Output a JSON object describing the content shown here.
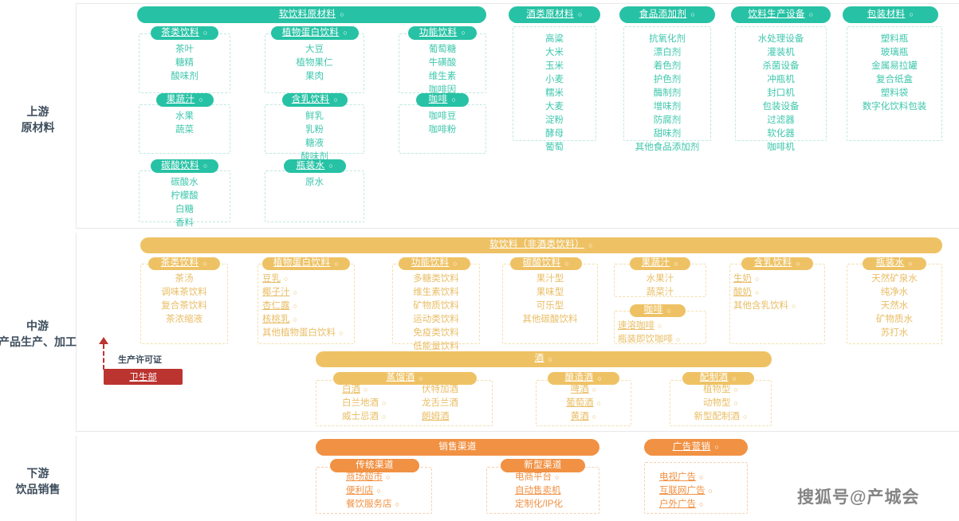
{
  "watermark": "搜狐号@产城会",
  "tiers": [
    {
      "id": "upstream",
      "label_line1": "上游",
      "label_line2": "原材料"
    },
    {
      "id": "midstream",
      "label_line1": "中游",
      "label_line2": "产品生产、加工"
    },
    {
      "id": "downstream",
      "label_line1": "下游",
      "label_line2": "饮品销售"
    }
  ],
  "colors": {
    "green": "#27c2a5",
    "yellow": "#eec264",
    "orange": "#f19143",
    "regulator": "#bc3430",
    "label_text": "#3d4d5c"
  },
  "regulator": {
    "name": "卫生部",
    "relation": "生产许可证"
  },
  "upstream": {
    "banner": {
      "title": "软饮料原材料",
      "dot": "○"
    },
    "groups": [
      {
        "title": "茶类饮料",
        "dot": "○",
        "items": [
          {
            "text": "茶叶"
          },
          {
            "text": "糖精"
          },
          {
            "text": "酸味剂"
          }
        ]
      },
      {
        "title": "植物蛋白饮料",
        "dot": "○",
        "items": [
          {
            "text": "大豆"
          },
          {
            "text": "植物果仁"
          },
          {
            "text": "果肉"
          }
        ]
      },
      {
        "title": "功能饮料",
        "dot": "○",
        "items": [
          {
            "text": "葡萄糖"
          },
          {
            "text": "牛磺酸"
          },
          {
            "text": "维生素"
          },
          {
            "text": "咖啡因"
          }
        ]
      },
      {
        "title": "果蔬汁",
        "dot": "○",
        "items": [
          {
            "text": "水果"
          },
          {
            "text": "蔬菜"
          }
        ]
      },
      {
        "title": "含乳饮料",
        "dot": "○",
        "items": [
          {
            "text": "鲜乳"
          },
          {
            "text": "乳粉"
          },
          {
            "text": "糖液"
          },
          {
            "text": "酸味剂"
          }
        ]
      },
      {
        "title": "咖啡",
        "dot": "○",
        "items": [
          {
            "text": "咖啡豆"
          },
          {
            "text": "咖啡粉"
          }
        ]
      },
      {
        "title": "碳酸饮料",
        "dot": "○",
        "items": [
          {
            "text": "碳酸水"
          },
          {
            "text": "柠檬酸"
          },
          {
            "text": "白糖"
          },
          {
            "text": "香料"
          }
        ]
      },
      {
        "title": "瓶装水",
        "dot": "○",
        "items": [
          {
            "text": "原水"
          }
        ]
      }
    ],
    "side_groups": [
      {
        "title": "酒类原材料",
        "dot": "○",
        "items": [
          {
            "text": "高粱"
          },
          {
            "text": "大米"
          },
          {
            "text": "玉米"
          },
          {
            "text": "小麦"
          },
          {
            "text": "糯米"
          },
          {
            "text": "大麦"
          },
          {
            "text": "淀粉"
          },
          {
            "text": "酵母"
          },
          {
            "text": "葡萄"
          }
        ]
      },
      {
        "title": "食品添加剂",
        "dot": "○",
        "items": [
          {
            "text": "抗氧化剂"
          },
          {
            "text": "漂白剂"
          },
          {
            "text": "着色剂"
          },
          {
            "text": "护色剂"
          },
          {
            "text": "酶制剂"
          },
          {
            "text": "增味剂"
          },
          {
            "text": "防腐剂"
          },
          {
            "text": "甜味剂"
          },
          {
            "text": "其他食品添加剂"
          }
        ]
      },
      {
        "title": "饮料生产设备",
        "dot": "○",
        "items": [
          {
            "text": "水处理设备"
          },
          {
            "text": "灌装机"
          },
          {
            "text": "杀菌设备"
          },
          {
            "text": "冲瓶机"
          },
          {
            "text": "封口机"
          },
          {
            "text": "包装设备"
          },
          {
            "text": "过滤器"
          },
          {
            "text": "软化器"
          },
          {
            "text": "咖啡机"
          }
        ]
      },
      {
        "title": "包装材料",
        "dot": "○",
        "items": [
          {
            "text": "塑料瓶"
          },
          {
            "text": "玻璃瓶"
          },
          {
            "text": "金属易拉罐"
          },
          {
            "text": "复合纸盒"
          },
          {
            "text": "塑料袋"
          },
          {
            "text": "数字化饮料包装"
          }
        ]
      }
    ]
  },
  "midstream": {
    "soft_banner": {
      "title": "软饮料（非酒类饮料）",
      "dot": "○"
    },
    "soft_groups": [
      {
        "title": "茶类饮料",
        "dot": "○",
        "items": [
          {
            "text": "茶汤"
          },
          {
            "text": "调味茶饮料"
          },
          {
            "text": "复合茶饮料"
          },
          {
            "text": "茶浓缩液"
          }
        ]
      },
      {
        "title": "植物蛋白饮料",
        "dot": "○",
        "items": [
          {
            "text": "豆乳",
            "link": true,
            "dot": "○"
          },
          {
            "text": "椰子汁",
            "link": true,
            "dot": "○"
          },
          {
            "text": "杏仁露",
            "link": true,
            "dot": "○"
          },
          {
            "text": "核桃乳",
            "link": true,
            "dot": "○"
          },
          {
            "text": "其他植物蛋白饮料",
            "dot": "○"
          }
        ]
      },
      {
        "title": "功能饮料",
        "dot": "○",
        "items": [
          {
            "text": "多糖类饮料"
          },
          {
            "text": "维生素饮料"
          },
          {
            "text": "矿物质饮料"
          },
          {
            "text": "运动类饮料"
          },
          {
            "text": "免疫类饮料"
          },
          {
            "text": "低能量饮料"
          }
        ]
      },
      {
        "title": "碳酸饮料",
        "dot": "○",
        "items": [
          {
            "text": "果汁型"
          },
          {
            "text": "果味型"
          },
          {
            "text": "可乐型"
          },
          {
            "text": "其他碳酸饮料"
          }
        ]
      },
      {
        "title": "果蔬汁",
        "dot": "○",
        "items": [
          {
            "text": "水果汁"
          },
          {
            "text": "蔬菜汁"
          }
        ]
      },
      {
        "title": "咖啡",
        "dot": "○",
        "items": [
          {
            "text": "速溶咖啡",
            "link": true,
            "dot": "○"
          },
          {
            "text": "瓶装即饮咖啡",
            "dot": "○"
          }
        ]
      },
      {
        "title": "含乳饮料",
        "dot": "○",
        "items": [
          {
            "text": "生奶",
            "link": true,
            "dot": "○"
          },
          {
            "text": "酸奶",
            "link": true,
            "dot": "○"
          },
          {
            "text": "其他含乳饮料",
            "dot": "○"
          }
        ]
      },
      {
        "title": "瓶装水",
        "dot": "○",
        "items": [
          {
            "text": "天然矿泉水"
          },
          {
            "text": "纯净水"
          },
          {
            "text": "天然水"
          },
          {
            "text": "矿物质水"
          },
          {
            "text": "苏打水"
          }
        ]
      }
    ],
    "alcohol_banner": {
      "title": "酒",
      "dot": "○"
    },
    "alcohol_groups": [
      {
        "title": "蒸馏酒",
        "dot": "○",
        "two_col": true,
        "col1": [
          {
            "text": "白酒",
            "link": true,
            "dot": "○"
          },
          {
            "text": "白兰地酒",
            "dot": "○"
          },
          {
            "text": "威士忌酒",
            "dot": "○"
          }
        ],
        "col2": [
          {
            "text": "伏特加酒"
          },
          {
            "text": "龙舌兰酒"
          },
          {
            "text": "朗姆酒",
            "link": true
          }
        ]
      },
      {
        "title": "酿造酒",
        "dot": "○",
        "items": [
          {
            "text": "啤酒",
            "link": true,
            "dot": "○"
          },
          {
            "text": "葡萄酒",
            "link": true,
            "dot": "○"
          },
          {
            "text": "黄酒",
            "link": true,
            "dot": "○"
          }
        ]
      },
      {
        "title": "配制酒",
        "dot": "○",
        "items": [
          {
            "text": "植物型",
            "dot": "○"
          },
          {
            "text": "动物型",
            "dot": "○"
          },
          {
            "text": "新型配制酒",
            "dot": "○"
          }
        ]
      }
    ]
  },
  "downstream": {
    "sales_banner": {
      "title": "销售渠道",
      "dot": ""
    },
    "sales_groups": [
      {
        "title": "传统渠道",
        "dot": "",
        "items": [
          {
            "text": "商场超市",
            "link": true,
            "dot": "○"
          },
          {
            "text": "便利店",
            "link": true,
            "dot": "○"
          },
          {
            "text": "餐饮服务店",
            "dot": "○"
          }
        ]
      },
      {
        "title": "新型渠道",
        "dot": "",
        "items": [
          {
            "text": "电商平台",
            "dot": "○"
          },
          {
            "text": "自动售卖机",
            "link": true
          },
          {
            "text": "定制化/IP化"
          }
        ]
      }
    ],
    "ads_banner": {
      "title": "广告营销",
      "dot": "○"
    },
    "ads_items": [
      {
        "text": "电视广告",
        "link": true,
        "dot": "○"
      },
      {
        "text": "互联网广告",
        "link": true,
        "dot": "○"
      },
      {
        "text": "户外广告",
        "link": true,
        "dot": "○"
      }
    ]
  }
}
